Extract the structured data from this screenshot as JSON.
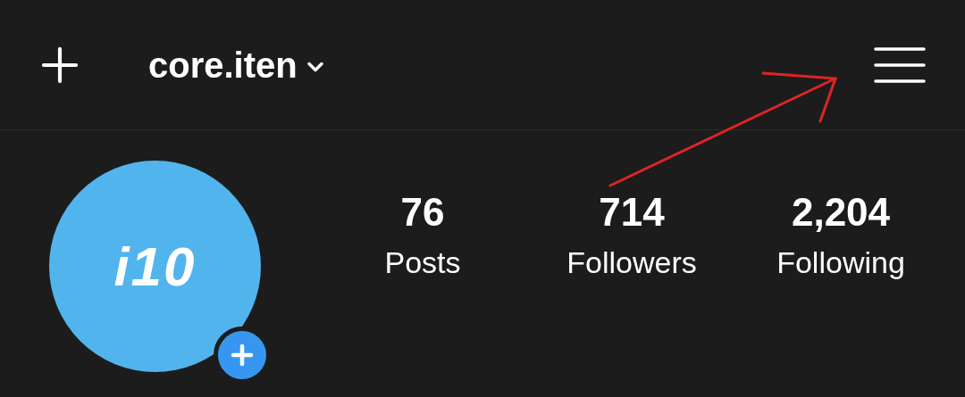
{
  "header": {
    "username": "core.iten"
  },
  "avatar": {
    "logo_text": "i10"
  },
  "stats": [
    {
      "value": "76",
      "label": "Posts"
    },
    {
      "value": "714",
      "label": "Followers"
    },
    {
      "value": "2,204",
      "label": "Following"
    }
  ]
}
